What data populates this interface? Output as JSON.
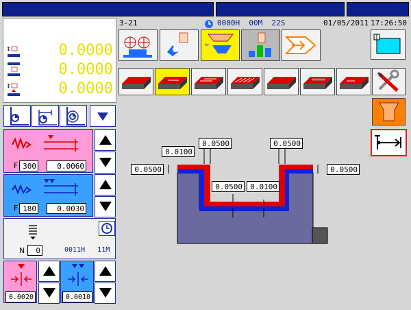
{
  "header": {
    "screen_id": "3-21",
    "hours": "0000",
    "hours_unit": "H",
    "minutes": "00",
    "minutes_unit": "M",
    "seconds": "22",
    "seconds_unit": "S",
    "date": "01/05/2011",
    "time": "17:26:50"
  },
  "readouts": {
    "axis1": "0.0000",
    "axis2": "0.0000",
    "axis3": "0.0000"
  },
  "cut1": {
    "f_label": "F",
    "feed": "300",
    "depth": "0.0060"
  },
  "cut2": {
    "f_label": "F",
    "feed": "180",
    "depth": "0.0030"
  },
  "spark": {
    "n_label": "N",
    "count": "0",
    "time_h": "0011H",
    "time_m": "11M"
  },
  "step1": {
    "value": "0.0020"
  },
  "step2": {
    "value": "0.0010"
  },
  "diagram": {
    "top_left_a": "0.0100",
    "top_left_b": "0.0500",
    "top_right": "0.0500",
    "left_side": "0.0500",
    "right_side": "0.0500",
    "mid_a": "0.0500",
    "mid_b": "0.0100"
  },
  "colors": {
    "title_bar": "#0b1f8f",
    "panel_red": "#ff9ad6",
    "panel_blue": "#3aa0ff",
    "material_red": "#e00000",
    "material_blue": "#1020e0",
    "workpiece": "#6a6a9e",
    "highlight": "#fff200"
  }
}
